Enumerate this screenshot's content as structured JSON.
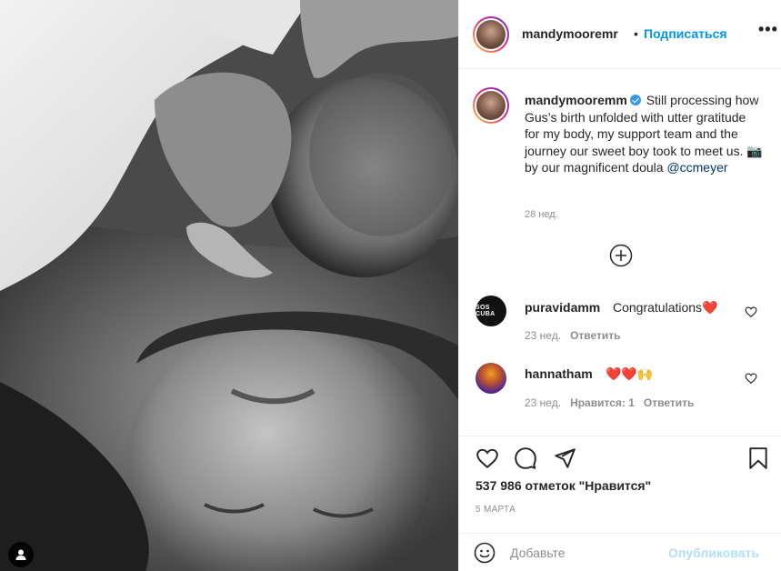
{
  "post": {
    "username": "mandymooremm",
    "header_username": "mandymooremr",
    "dot": "•",
    "follow_label": "Подписаться",
    "more_label": "•••",
    "caption_text": "Still processing how Gus’s birth unfolded with utter gratitude for my body, my support team and the journey our sweet boy took to meet us. 📷 by our magnificent doula",
    "caption_mention": "@ccmeyer",
    "caption_time": "28 нед.",
    "verified": true,
    "likes": "537 986 отметок \"Нравится\"",
    "date": "5 МАРТА"
  },
  "comments": [
    {
      "username": "puravidamm",
      "text": "Congratulations",
      "emoji": "❤️",
      "avatar_text": "SOS CUBA",
      "time": "23 нед.",
      "reply_label": "Ответить",
      "likes_label": ""
    },
    {
      "username": "hannatham",
      "text": "",
      "emoji": "❤️❤️🙌",
      "avatar_text": "",
      "time": "23 нед.",
      "reply_label": "Ответить",
      "likes_label": "Нравится: 1"
    }
  ],
  "add_comment": {
    "placeholder": "Добавьте",
    "post_label": "Опубликовать"
  },
  "icons": {
    "heart": "heart-icon",
    "comment": "comment-icon",
    "share": "share-icon",
    "save": "bookmark-icon",
    "emoji": "emoji-icon",
    "load_more": "plus-circle-icon",
    "user_tag": "user-tag-icon"
  },
  "colors": {
    "link": "#0095f6",
    "mention": "#00376b",
    "secondary_text": "#8e8e8e",
    "like_red": "#ed4956",
    "post_disabled": "#b2dffc"
  }
}
